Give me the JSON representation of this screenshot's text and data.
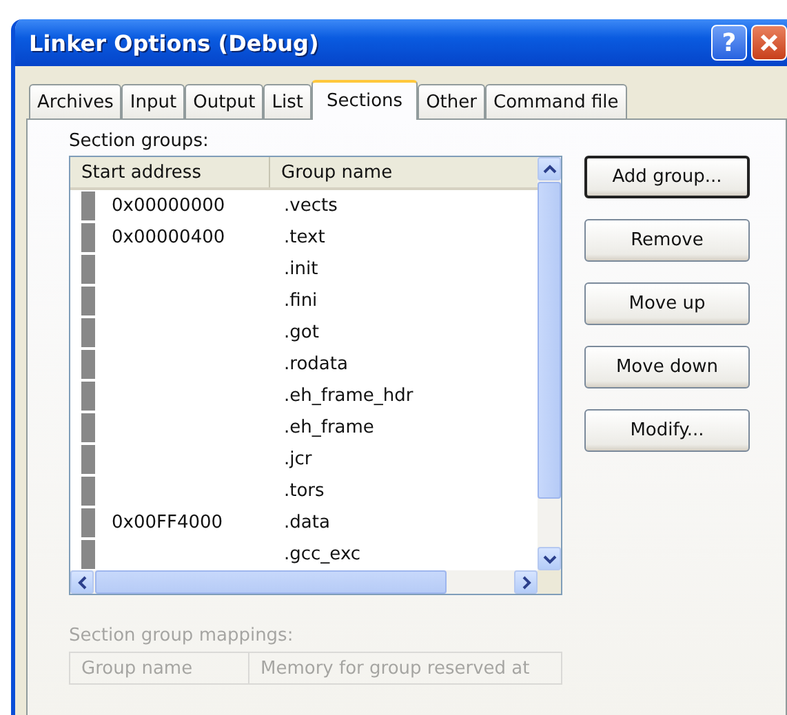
{
  "window": {
    "title": "Linker Options (Debug)",
    "help_button": "?"
  },
  "tabs": [
    {
      "label": "Archives",
      "selected": false
    },
    {
      "label": "Input",
      "selected": false
    },
    {
      "label": "Output",
      "selected": false
    },
    {
      "label": "List",
      "selected": false
    },
    {
      "label": "Sections",
      "selected": true
    },
    {
      "label": "Other",
      "selected": false
    },
    {
      "label": "Command file",
      "selected": false
    }
  ],
  "section_groups": {
    "label": "Section groups:",
    "columns": [
      "Start address",
      "Group name"
    ],
    "rows": [
      {
        "start_address": "0x00000000",
        "group_name": ".vects"
      },
      {
        "start_address": "0x00000400",
        "group_name": ".text"
      },
      {
        "start_address": "",
        "group_name": ".init"
      },
      {
        "start_address": "",
        "group_name": ".fini"
      },
      {
        "start_address": "",
        "group_name": ".got"
      },
      {
        "start_address": "",
        "group_name": ".rodata"
      },
      {
        "start_address": "",
        "group_name": ".eh_frame_hdr"
      },
      {
        "start_address": "",
        "group_name": ".eh_frame"
      },
      {
        "start_address": "",
        "group_name": ".jcr"
      },
      {
        "start_address": "",
        "group_name": ".tors"
      },
      {
        "start_address": "0x00FF4000",
        "group_name": ".data"
      },
      {
        "start_address": "",
        "group_name": ".gcc_exc"
      }
    ]
  },
  "buttons": [
    {
      "label": "Add group...",
      "default": true
    },
    {
      "label": "Remove",
      "default": false
    },
    {
      "label": "Move up",
      "default": false
    },
    {
      "label": "Move down",
      "default": false
    },
    {
      "label": "Modify...",
      "default": false
    }
  ],
  "section_group_mappings": {
    "label": "Section group mappings:",
    "columns": [
      "Group name",
      "Memory for group reserved at"
    ]
  }
}
